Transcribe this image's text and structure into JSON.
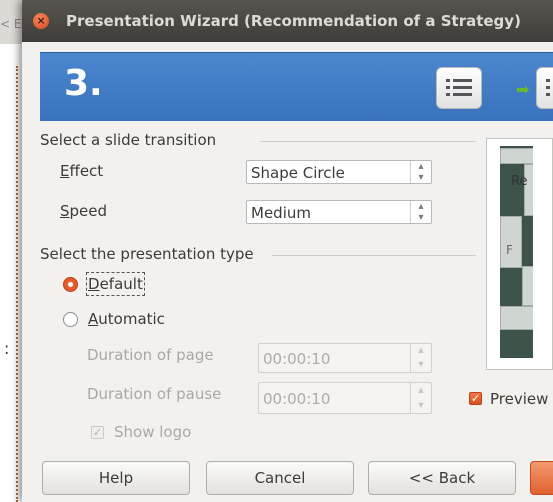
{
  "background": {
    "tab_fragment": "< E"
  },
  "dialog": {
    "title": "Presentation Wizard (Recommendation of a Strategy)",
    "step": "3."
  },
  "transition_group": {
    "label": "Select a slide transition",
    "effect_label": "Effect",
    "effect_value": "Shape Circle",
    "speed_label": "Speed",
    "speed_value": "Medium"
  },
  "presentation_type_group": {
    "label": "Select the presentation type",
    "default_label": "Default",
    "default_selected": true,
    "automatic_label": "Automatic",
    "automatic_selected": false,
    "duration_page_label": "Duration of page",
    "duration_page_value": "00:00:10",
    "duration_pause_label": "Duration of pause",
    "duration_pause_value": "00:00:10",
    "show_logo_label": "Show logo",
    "show_logo_checked": true
  },
  "preview": {
    "checkbox_label": "Preview",
    "checked": true,
    "slide_text": "Re",
    "slide_letter": "F"
  },
  "buttons": {
    "help": "Help",
    "cancel": "Cancel",
    "back": "<< Back"
  },
  "colors": {
    "accent": "#e0612f",
    "banner": "#3a73bd",
    "titlebar": "#3e3d39"
  },
  "icons": [
    "close-icon",
    "outline-icon",
    "next-arrow-icon"
  ]
}
